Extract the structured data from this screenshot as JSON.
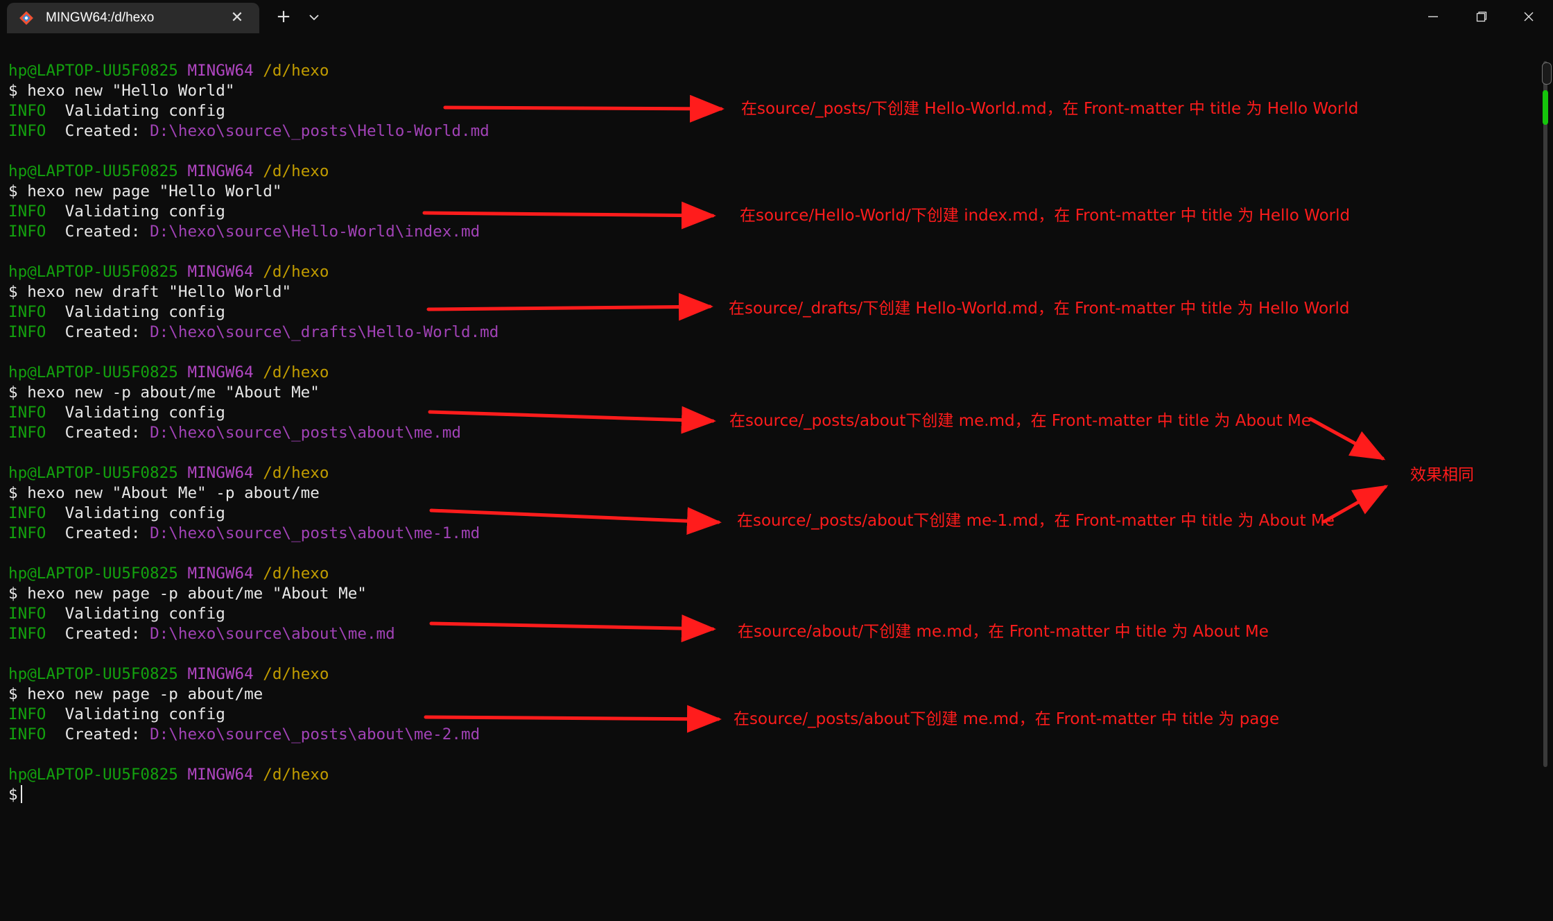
{
  "window": {
    "tab_title": "MINGW64:/d/hexo",
    "tab_icon": "git-diamond-icon",
    "close_tab_glyph": "✕",
    "new_tab_glyph": "+",
    "controls": [
      "minimize-icon",
      "restore-icon",
      "close-icon"
    ]
  },
  "prompt": {
    "user_host": "hp@LAPTOP-UU5F0825",
    "shell": "MINGW64",
    "path": "/d/hexo"
  },
  "blocks": [
    {
      "command": "$ hexo new \"Hello World\"",
      "info1": "Validating config",
      "created_label": "Created:",
      "created_path": "D:\\hexo\\source\\_posts\\Hello-World.md"
    },
    {
      "command": "$ hexo new page \"Hello World\"",
      "info1": "Validating config",
      "created_label": "Created:",
      "created_path": "D:\\hexo\\source\\Hello-World\\index.md"
    },
    {
      "command": "$ hexo new draft \"Hello World\"",
      "info1": "Validating config",
      "created_label": "Created:",
      "created_path": "D:\\hexo\\source\\_drafts\\Hello-World.md"
    },
    {
      "command": "$ hexo new -p about/me \"About Me\"",
      "info1": "Validating config",
      "created_label": "Created:",
      "created_path": "D:\\hexo\\source\\_posts\\about\\me.md"
    },
    {
      "command": "$ hexo new \"About Me\" -p about/me",
      "info1": "Validating config",
      "created_label": "Created:",
      "created_path": "D:\\hexo\\source\\_posts\\about\\me-1.md"
    },
    {
      "command": "$ hexo new page -p about/me \"About Me\"",
      "info1": "Validating config",
      "created_label": "Created:",
      "created_path": "D:\\hexo\\source\\about\\me.md"
    },
    {
      "command": "$ hexo new page -p about/me",
      "info1": "Validating config",
      "created_label": "Created:",
      "created_path": "D:\\hexo\\source\\_posts\\about\\me-2.md"
    }
  ],
  "info_tag": "INFO",
  "final_prompt": "$",
  "annotations": [
    "在source/_posts/下创建 Hello-World.md，在 Front-matter 中 title 为 Hello World",
    "在source/Hello-World/下创建 index.md，在 Front-matter 中 title 为 Hello World",
    "在source/_drafts/下创建 Hello-World.md，在 Front-matter 中 title 为 Hello World",
    "在source/_posts/about下创建 me.md，在 Front-matter 中 title 为 About Me",
    "在source/_posts/about下创建 me-1.md，在 Front-matter 中 title 为 About Me",
    "在source/about/下创建 me.md，在 Front-matter 中 title 为 About Me",
    "在source/_posts/about下创建 me.md，在 Front-matter 中 title 为 page"
  ],
  "same_effect_note": "效果相同",
  "colors": {
    "background": "#0c0c0c",
    "prompt_green": "#13a10e",
    "prompt_magenta": "#b146c2",
    "prompt_yellow": "#c19c00",
    "path_purple": "#a142b6",
    "annotation_red": "#ff1c1c",
    "scroll_thumb": "#16c60c"
  }
}
